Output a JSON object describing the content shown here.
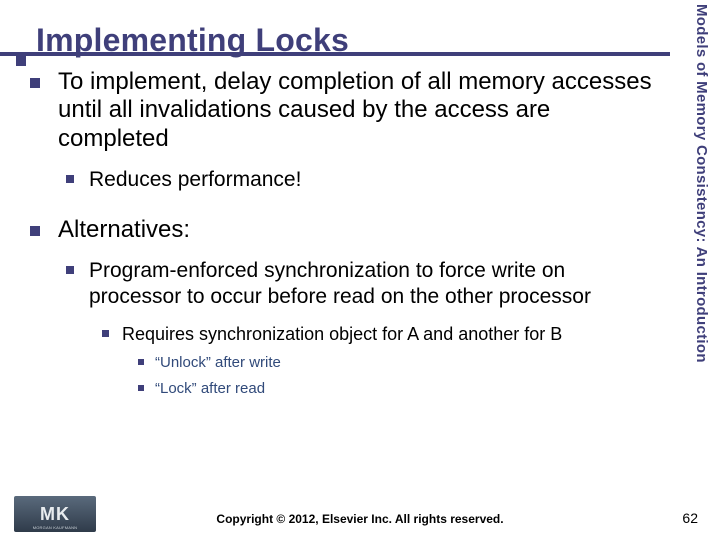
{
  "title": "Implementing Locks",
  "sidebar_label": "Models of Memory Consistency: An Introduction",
  "bullets": {
    "b1a": "To implement, delay completion of all memory accesses until all invalidations caused by the access are completed",
    "b2a": "Reduces performance!",
    "b1b": "Alternatives:",
    "b2b": "Program-enforced synchronization to force write on processor to occur before read on the other processor",
    "b3a": "Requires synchronization object for A and another for B",
    "b4a": "“Unlock” after write",
    "b4b": "“Lock” after read"
  },
  "footer": {
    "logo_main": "MK",
    "logo_sub": "MORGAN KAUFMANN",
    "copyright": "Copyright © 2012, Elsevier Inc. All rights reserved.",
    "page": "62"
  }
}
